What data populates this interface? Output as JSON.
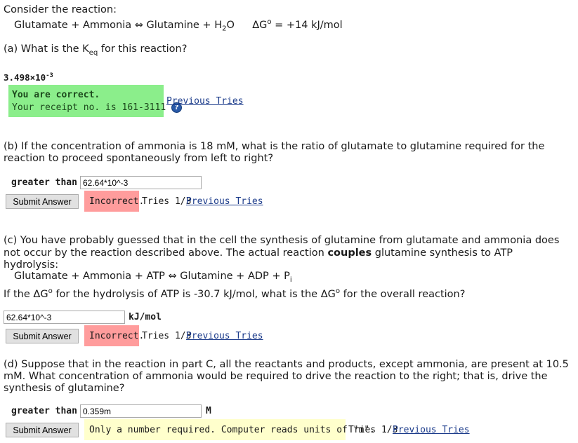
{
  "intro": {
    "line1": "Consider the reaction:",
    "reactants": "Glutamate + Ammonia",
    "arrow": "⇔",
    "products_a": "Glutamine + H",
    "h2o_sub": "2",
    "products_b": "O",
    "dg_label": "ΔG",
    "dg_sup": "o",
    "dg_value": " = +14 kJ/mol"
  },
  "part_a": {
    "question_a": "(a) What is the K",
    "keq_sub": "eq",
    "question_b": " for this reaction?",
    "answer_base": "3.498×10",
    "answer_exp": "-3",
    "correct_title": "You are correct.",
    "receipt": "Your receipt no. is 161-3111",
    "previous_tries": "Previous Tries"
  },
  "part_b": {
    "question": "(b) If the concentration of ammonia is 18 mM, what is the ratio of glutamate to glutamine required for the reaction to proceed spontaneously from left to right?",
    "prefix": "greater than",
    "input_value": "62.64*10^-3",
    "submit": "Submit Answer",
    "status": "Incorrect.",
    "tries": "Tries 1/3",
    "previous_tries": "Previous Tries"
  },
  "part_c": {
    "question1": "(c) You have probably guessed that in the cell the synthesis of glutamine from glutamate and ammonia does not occur by the reaction described above. The actual reaction",
    "couples": "couples",
    "question2": "glutamine synthesis to ATP hydrolysis:",
    "reaction": "Glutamate + Ammonia + ATP ⇔ Glutamine + ADP + P",
    "pi_sub": "i",
    "ask_a": "If the ΔG",
    "ask_sup1": "o",
    "ask_b": " for the hydrolysis of ATP is -30.7 kJ/mol, what is the ΔG",
    "ask_sup2": "o",
    "ask_c": " for the overall reaction?",
    "input_value": "62.64*10^-3",
    "unit": "kJ/mol",
    "submit": "Submit Answer",
    "status": "Incorrect.",
    "tries": "Tries 1/3",
    "previous_tries": "Previous Tries"
  },
  "part_d": {
    "question": "(d) Suppose that in the reaction in part C, all the reactants and products, except ammonia, are present at 10.5 mM. What concentration of ammonia would be required to drive the reaction to the right; that is, drive the synthesis of glutamine?",
    "prefix": "greater than",
    "input_value": "0.359m",
    "unit": "M",
    "submit": "Submit Answer",
    "hint": "Only a number required. Computer reads units of \"m\".",
    "tries": "Tries 1/3",
    "previous_tries": "Previous Tries"
  }
}
